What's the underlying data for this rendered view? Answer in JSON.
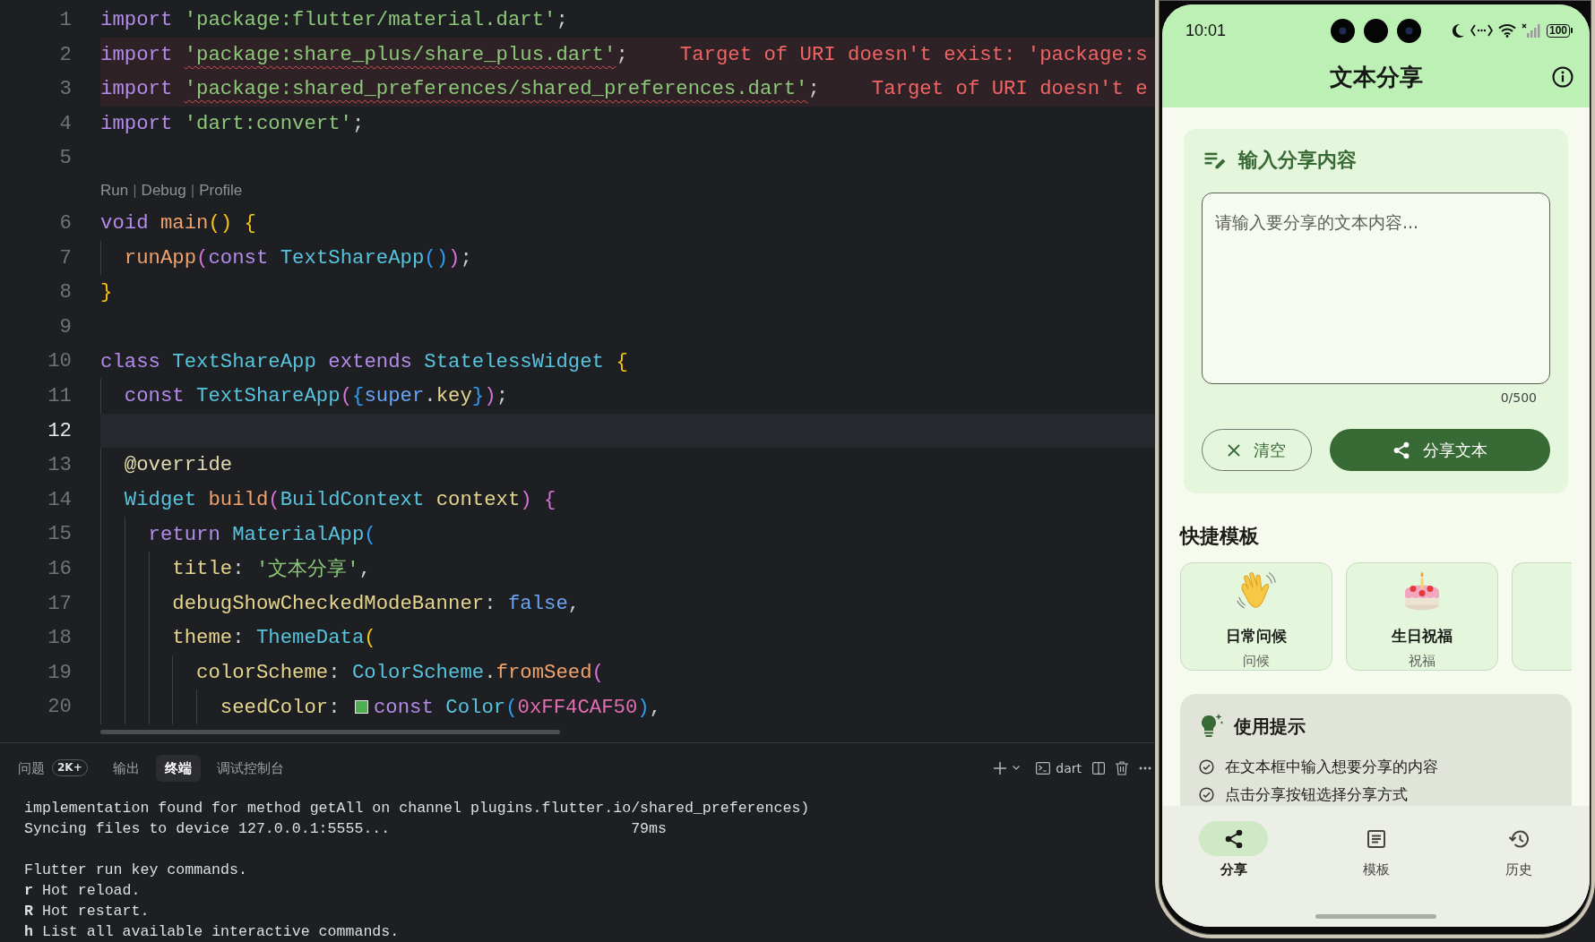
{
  "editor": {
    "lines": [
      {
        "kind": "code",
        "number": "1",
        "current": false,
        "error": false,
        "tokens": [
          {
            "kind": "keyword",
            "text": "import "
          },
          {
            "kind": "string",
            "text": "'package:flutter/material.dart'"
          },
          {
            "kind": "plain",
            "text": ";"
          }
        ]
      },
      {
        "kind": "code",
        "number": "2",
        "current": false,
        "error": true,
        "tokens": [
          {
            "kind": "keyword",
            "text": "import "
          },
          {
            "kind": "string",
            "text": "'package:share_plus/share_plus.dart'"
          },
          {
            "kind": "plain",
            "text": ";"
          }
        ],
        "diagnostic": "Target of URI doesn't exist: 'package:s"
      },
      {
        "kind": "code",
        "number": "3",
        "current": false,
        "error": true,
        "tokens": [
          {
            "kind": "keyword",
            "text": "import "
          },
          {
            "kind": "string",
            "text": "'package:shared_preferences/shared_preferences.dart'"
          },
          {
            "kind": "plain",
            "text": ";"
          }
        ],
        "diagnostic": "Target of URI doesn't e"
      },
      {
        "kind": "code",
        "number": "4",
        "current": false,
        "error": false,
        "tokens": [
          {
            "kind": "keyword",
            "text": "import "
          },
          {
            "kind": "string",
            "text": "'dart:convert'"
          },
          {
            "kind": "plain",
            "text": ";"
          }
        ]
      },
      {
        "kind": "code",
        "number": "5",
        "current": false,
        "error": false
      },
      {
        "kind": "codelens",
        "actions": [
          {
            "kind": "link",
            "text": "Run"
          },
          {
            "kind": "separator",
            "text": "|"
          },
          {
            "kind": "link",
            "text": "Debug"
          },
          {
            "kind": "separator",
            "text": "|"
          },
          {
            "kind": "link",
            "text": "Profile"
          }
        ]
      },
      {
        "kind": "code",
        "number": "6",
        "current": false,
        "error": false,
        "tokens": [
          {
            "kind": "keyword",
            "text": "void "
          },
          {
            "kind": "function",
            "text": "main"
          },
          {
            "kind": "bracket1",
            "text": "() "
          },
          {
            "kind": "bracket1",
            "text": "{"
          }
        ]
      },
      {
        "kind": "code",
        "number": "7",
        "current": false,
        "error": false,
        "tokens": [
          {
            "kind": "indent"
          },
          {
            "kind": "function",
            "text": "runApp"
          },
          {
            "kind": "bracket2",
            "text": "("
          },
          {
            "kind": "keyword",
            "text": "const "
          },
          {
            "kind": "type",
            "text": "TextShareApp"
          },
          {
            "kind": "bracket3",
            "text": "()"
          },
          {
            "kind": "bracket2",
            "text": ")"
          },
          {
            "kind": "plain",
            "text": ";"
          }
        ]
      },
      {
        "kind": "code",
        "number": "8",
        "current": false,
        "error": false,
        "tokens": [
          {
            "kind": "bracket1",
            "text": "}"
          }
        ]
      },
      {
        "kind": "code",
        "number": "9",
        "current": false,
        "error": false
      },
      {
        "kind": "code",
        "number": "10",
        "current": false,
        "error": false,
        "tokens": [
          {
            "kind": "keyword",
            "text": "class "
          },
          {
            "kind": "type",
            "text": "TextShareApp "
          },
          {
            "kind": "keyword",
            "text": "extends "
          },
          {
            "kind": "type",
            "text": "StatelessWidget "
          },
          {
            "kind": "bracket1",
            "text": "{"
          }
        ]
      },
      {
        "kind": "code",
        "number": "11",
        "current": false,
        "error": false,
        "tokens": [
          {
            "kind": "indent"
          },
          {
            "kind": "keyword",
            "text": "const "
          },
          {
            "kind": "type",
            "text": "TextShareApp"
          },
          {
            "kind": "bracket2",
            "text": "("
          },
          {
            "kind": "bracket3",
            "text": "{"
          },
          {
            "kind": "literal",
            "text": "super"
          },
          {
            "kind": "plain",
            "text": "."
          },
          {
            "kind": "property",
            "text": "key"
          },
          {
            "kind": "bracket3",
            "text": "}"
          },
          {
            "kind": "bracket2",
            "text": ")"
          },
          {
            "kind": "plain",
            "text": ";"
          }
        ]
      },
      {
        "kind": "code",
        "number": "12",
        "current": true,
        "error": false
      },
      {
        "kind": "code",
        "number": "13",
        "current": false,
        "error": false,
        "tokens": [
          {
            "kind": "indent"
          },
          {
            "kind": "annotation",
            "text": "@override"
          }
        ]
      },
      {
        "kind": "code",
        "number": "14",
        "current": false,
        "error": false,
        "tokens": [
          {
            "kind": "indent"
          },
          {
            "kind": "type",
            "text": "Widget "
          },
          {
            "kind": "function",
            "text": "build"
          },
          {
            "kind": "bracket2",
            "text": "("
          },
          {
            "kind": "type",
            "text": "BuildContext "
          },
          {
            "kind": "property",
            "text": "context"
          },
          {
            "kind": "bracket2",
            "text": ") "
          },
          {
            "kind": "bracket2",
            "text": "{"
          }
        ]
      },
      {
        "kind": "code",
        "number": "15",
        "current": false,
        "error": false,
        "tokens": [
          {
            "kind": "indent"
          },
          {
            "kind": "indent"
          },
          {
            "kind": "keyword",
            "text": "return "
          },
          {
            "kind": "type",
            "text": "MaterialApp"
          },
          {
            "kind": "bracket3",
            "text": "("
          }
        ]
      },
      {
        "kind": "code",
        "number": "16",
        "current": false,
        "error": false,
        "tokens": [
          {
            "kind": "indent"
          },
          {
            "kind": "indent"
          },
          {
            "kind": "indent"
          },
          {
            "kind": "property",
            "text": "title"
          },
          {
            "kind": "plain",
            "text": ": "
          },
          {
            "kind": "string",
            "text": "'文本分享'"
          },
          {
            "kind": "plain",
            "text": ","
          }
        ]
      },
      {
        "kind": "code",
        "number": "17",
        "current": false,
        "error": false,
        "tokens": [
          {
            "kind": "indent"
          },
          {
            "kind": "indent"
          },
          {
            "kind": "indent"
          },
          {
            "kind": "property",
            "text": "debugShowCheckedModeBanner"
          },
          {
            "kind": "plain",
            "text": ": "
          },
          {
            "kind": "literal",
            "text": "false"
          },
          {
            "kind": "plain",
            "text": ","
          }
        ]
      },
      {
        "kind": "code",
        "number": "18",
        "current": false,
        "error": false,
        "tokens": [
          {
            "kind": "indent"
          },
          {
            "kind": "indent"
          },
          {
            "kind": "indent"
          },
          {
            "kind": "property",
            "text": "theme"
          },
          {
            "kind": "plain",
            "text": ": "
          },
          {
            "kind": "type",
            "text": "ThemeData"
          },
          {
            "kind": "bracket1",
            "text": "("
          }
        ]
      },
      {
        "kind": "code",
        "number": "19",
        "current": false,
        "error": false,
        "tokens": [
          {
            "kind": "indent"
          },
          {
            "kind": "indent"
          },
          {
            "kind": "indent"
          },
          {
            "kind": "indent"
          },
          {
            "kind": "property",
            "text": "colorScheme"
          },
          {
            "kind": "plain",
            "text": ": "
          },
          {
            "kind": "type",
            "text": "ColorScheme"
          },
          {
            "kind": "plain",
            "text": "."
          },
          {
            "kind": "function",
            "text": "fromSeed"
          },
          {
            "kind": "bracket2",
            "text": "("
          }
        ]
      },
      {
        "kind": "code",
        "number": "20",
        "current": false,
        "error": false,
        "tokens": [
          {
            "kind": "indent"
          },
          {
            "kind": "indent"
          },
          {
            "kind": "indent"
          },
          {
            "kind": "indent"
          },
          {
            "kind": "indent"
          },
          {
            "kind": "property",
            "text": "seedColor"
          },
          {
            "kind": "plain",
            "text": ": "
          },
          {
            "kind": "swatch",
            "color": "#4caf50"
          },
          {
            "kind": "keyword",
            "text": "const "
          },
          {
            "kind": "type",
            "text": "Color"
          },
          {
            "kind": "bracket3",
            "text": "("
          },
          {
            "kind": "number",
            "text": "0xFF4CAF50"
          },
          {
            "kind": "bracket3",
            "text": ")"
          },
          {
            "kind": "plain",
            "text": ","
          }
        ]
      }
    ]
  },
  "panel": {
    "tabs": [
      {
        "label": "问题",
        "badge": "2K+",
        "selected": false
      },
      {
        "label": "输出",
        "selected": false
      },
      {
        "label": "终端",
        "selected": true
      },
      {
        "label": "调试控制台",
        "selected": false
      }
    ],
    "toolbar": {
      "terminal_name": "dart"
    },
    "terminal_blocks": [
      [
        "implementation found for method getAll on channel plugins.flutter.io/shared_preferences)",
        "Syncing files to device 127.0.0.1:5555...                           79ms"
      ],
      [
        "Flutter run key commands.",
        "**r** Hot reload.",
        "**R** Hot restart.",
        "**h** List all available interactive commands."
      ]
    ]
  },
  "phone": {
    "status_bar": {
      "time": "10:01",
      "battery": "100"
    },
    "app_bar": {
      "title": "文本分享"
    },
    "input_card": {
      "title": "输入分享内容",
      "placeholder": "请输入要分享的文本内容...",
      "counter": "0/500",
      "buttons": [
        {
          "kind": "outlined",
          "label": "清空"
        },
        {
          "kind": "filled",
          "label": "分享文本"
        }
      ]
    },
    "templates": {
      "title": "快捷模板",
      "items": [
        {
          "kind": "greeting",
          "title": "日常问候",
          "subtitle": "问候"
        },
        {
          "kind": "birthday",
          "title": "生日祝福",
          "subtitle": "祝福"
        },
        {
          "kind": "clipped"
        }
      ]
    },
    "tips": {
      "title": "使用提示",
      "items": [
        "在文本框中输入想要分享的内容",
        "点击分享按钮选择分享方式"
      ]
    },
    "nav": [
      {
        "label": "分享",
        "selected": true
      },
      {
        "label": "模板",
        "selected": false
      },
      {
        "label": "历史",
        "selected": false
      }
    ]
  }
}
